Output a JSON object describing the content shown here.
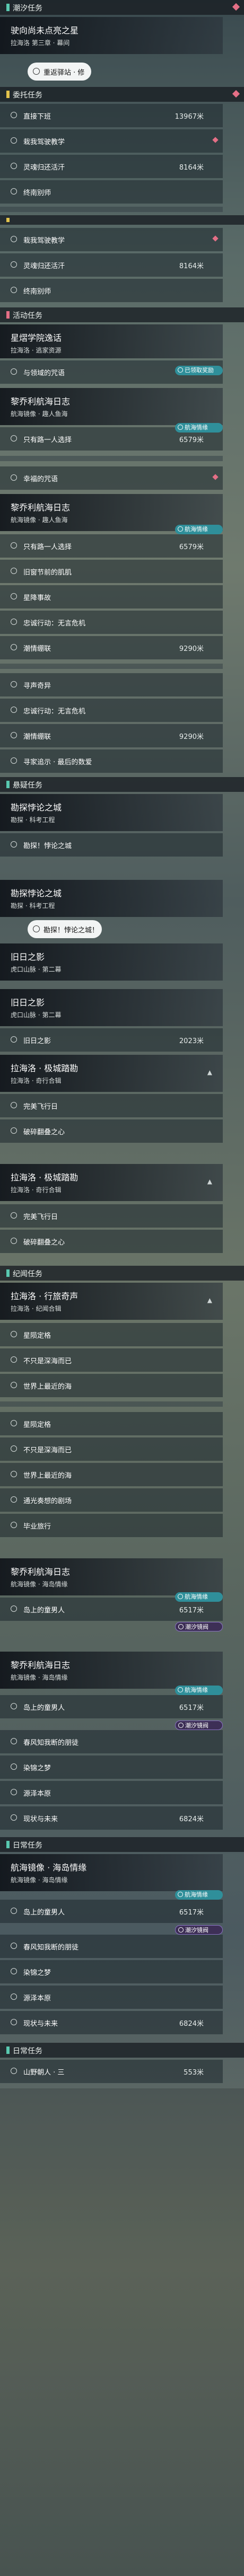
{
  "colors": {
    "accent_teal": "#2f8f9a",
    "accent_pink": "#e46f86",
    "accent_purple": "#8a72c3",
    "section_mark_teal": "#59c9b0",
    "section_mark_yellow": "#e2c24c"
  },
  "sections": {
    "s1": "潮汐任务",
    "s2": "委托任务",
    "s3": "活动任务",
    "s4": "悬疑任务",
    "s5": "纪闻任务",
    "s6": "日常任务",
    "s7": "日常任务"
  },
  "quests": {
    "q1": {
      "title": "驶向尚未点亮之星",
      "sub": "拉海洛 第三章 · 幕间"
    },
    "q2": {
      "title": "星熠学院逸话",
      "sub": "拉海洛 · 逃家资源"
    },
    "q3": {
      "title": "黎乔利航海日志",
      "sub": "航海镜像 · 趣人鱼海"
    },
    "q4": {
      "title": "黎乔利航海日志",
      "sub": "航海镜像 · 趣人鱼海"
    },
    "q5": {
      "title": "勘探悖论之城",
      "sub": "勘探 · 科考工程"
    },
    "q6": {
      "title": "勘探悖论之城",
      "sub": "勘探 · 科考工程"
    },
    "q7": {
      "title": "旧日之影",
      "sub": "虎口山脉 · 第二幕"
    },
    "q8": {
      "title": "旧日之影",
      "sub": "虎口山脉 · 第二幕"
    },
    "q9": {
      "title": "拉海洛 · 极城踏勘",
      "sub": "拉海洛 · 奇行合辑"
    },
    "q10": {
      "title": "拉海洛 · 极城踏勘",
      "sub": "拉海洛 · 奇行合辑"
    },
    "q11": {
      "title": "拉海洛 · 行旅奇声",
      "sub": "拉海洛 · 纪闻合辑"
    },
    "q12": {
      "title": "黎乔利航海日志",
      "sub": "航海镜像 · 海岛情缘"
    },
    "q13": {
      "title": "黎乔利航海日志",
      "sub": "航海镜像 · 海岛情缘"
    },
    "q14": {
      "title": "航海镜像 · 海岛情缘",
      "sub": "航海镜像 · 海岛情缘"
    }
  },
  "pills": {
    "p1": "重返驿站 · 修",
    "p2": "勘探！悖论之城！"
  },
  "badges": {
    "voyage": "航海情缘",
    "tide": "潮汐镜阀",
    "reward": "已领取奖励"
  },
  "objectives": [
    {
      "text": "直接下班",
      "dist": "13967米"
    },
    {
      "text": "栽我驾驶教学",
      "dist": ""
    },
    {
      "text": "灵魂归还活汗",
      "dist": "8164米"
    },
    {
      "text": "终南别师",
      "dist": ""
    },
    {
      "text": "栽我驾驶教学",
      "dist": ""
    },
    {
      "text": "灵魂归还活汗",
      "dist": "8164米"
    },
    {
      "text": "终南别师",
      "dist": ""
    },
    {
      "text": "与领域的咒语",
      "dist": ""
    },
    {
      "text": "只有路一人选择",
      "dist": "6579米"
    },
    {
      "text": "幸福的咒语",
      "dist": ""
    },
    {
      "text": "只有路一人选择",
      "dist": "6579米"
    },
    {
      "text": "旧窗节前的肌肌",
      "dist": ""
    },
    {
      "text": "星降事故",
      "dist": ""
    },
    {
      "text": "忠诚行动：无言危机",
      "dist": ""
    },
    {
      "text": "潮情绷联",
      "dist": "9290米"
    },
    {
      "text": "寻声奇异",
      "dist": ""
    },
    {
      "text": "忠诚行动：无言危机",
      "dist": ""
    },
    {
      "text": "潮情绷联",
      "dist": "9290米"
    },
    {
      "text": "寻家追示 · 最后的数爱",
      "dist": ""
    },
    {
      "text": "旧日之影",
      "dist": "2023米"
    },
    {
      "text": "勘探！悖论之城",
      "dist": ""
    },
    {
      "text": "完美飞行日",
      "dist": ""
    },
    {
      "text": "破碎翻叠之心",
      "dist": ""
    },
    {
      "text": "完美飞行日",
      "dist": ""
    },
    {
      "text": "破碎翻叠之心",
      "dist": ""
    },
    {
      "text": "星陨定格",
      "dist": ""
    },
    {
      "text": "不只是深海而已",
      "dist": ""
    },
    {
      "text": "世界上最近的海",
      "dist": ""
    },
    {
      "text": "星陨定格",
      "dist": ""
    },
    {
      "text": "不只是深海而已",
      "dist": ""
    },
    {
      "text": "世界上最近的海",
      "dist": ""
    },
    {
      "text": "通光奏想的剧场",
      "dist": ""
    },
    {
      "text": "毕业旅行",
      "dist": ""
    },
    {
      "text": "岛上的童男人",
      "dist": "6517米"
    },
    {
      "text": "岛上的童男人",
      "dist": "6517米"
    },
    {
      "text": "春风知我断的朋徒",
      "dist": ""
    },
    {
      "text": "染锦之梦",
      "dist": ""
    },
    {
      "text": "源泽本原",
      "dist": ""
    },
    {
      "text": "现状与未来",
      "dist": "6824米"
    },
    {
      "text": "岛上的童男人",
      "dist": "6517米"
    },
    {
      "text": "春风知我断的朋徒",
      "dist": ""
    },
    {
      "text": "染锦之梦",
      "dist": ""
    },
    {
      "text": "源泽本原",
      "dist": ""
    },
    {
      "text": "现状与未来",
      "dist": "6824米"
    },
    {
      "text": "山野朝人 · 三",
      "dist": "553米"
    }
  ]
}
